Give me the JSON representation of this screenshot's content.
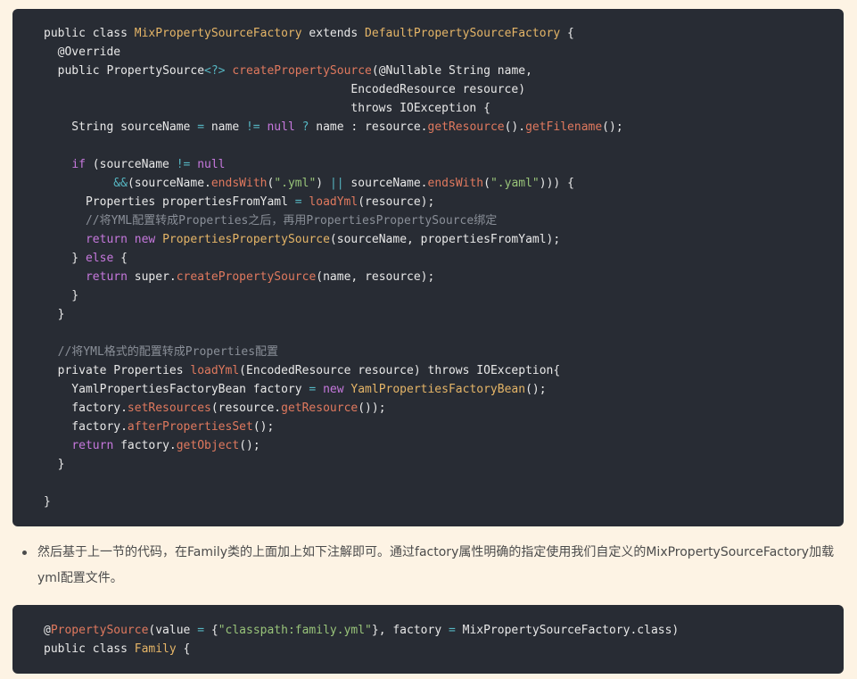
{
  "code_blocks": [
    {
      "lines": [
        [
          [
            "kw",
            "public class "
          ],
          [
            "type",
            "MixPropertySourceFactory"
          ],
          [
            "kw",
            " extends "
          ],
          [
            "type",
            "DefaultPropertySourceFactory"
          ],
          [
            "plain",
            " {"
          ]
        ],
        [
          [
            "plain",
            "  "
          ],
          [
            "ann",
            "@Override"
          ]
        ],
        [
          [
            "plain",
            "  "
          ],
          [
            "kw",
            "public "
          ],
          [
            "plain",
            "PropertySource"
          ],
          [
            "op",
            "<?>"
          ],
          [
            "plain",
            " "
          ],
          [
            "fn",
            "createPropertySource"
          ],
          [
            "plain",
            "("
          ],
          [
            "ann",
            "@Nullable"
          ],
          [
            "plain",
            " String name,"
          ]
        ],
        [
          [
            "plain",
            "                                            EncodedResource resource)"
          ]
        ],
        [
          [
            "plain",
            "                                            "
          ],
          [
            "kw",
            "throws"
          ],
          [
            "plain",
            " IOException {"
          ]
        ],
        [
          [
            "plain",
            "    String sourceName "
          ],
          [
            "op",
            "="
          ],
          [
            "plain",
            " name "
          ],
          [
            "op",
            "!="
          ],
          [
            "plain",
            " "
          ],
          [
            "kw2",
            "null"
          ],
          [
            "plain",
            " "
          ],
          [
            "op",
            "?"
          ],
          [
            "plain",
            " name : resource."
          ],
          [
            "fn",
            "getResource"
          ],
          [
            "plain",
            "()."
          ],
          [
            "fn",
            "getFilename"
          ],
          [
            "plain",
            "();"
          ]
        ],
        [],
        [
          [
            "plain",
            "    "
          ],
          [
            "kw2",
            "if"
          ],
          [
            "plain",
            " (sourceName "
          ],
          [
            "op",
            "!="
          ],
          [
            "plain",
            " "
          ],
          [
            "kw2",
            "null"
          ]
        ],
        [
          [
            "plain",
            "          "
          ],
          [
            "op",
            "&&"
          ],
          [
            "plain",
            "(sourceName."
          ],
          [
            "fn",
            "endsWith"
          ],
          [
            "plain",
            "("
          ],
          [
            "str",
            "\".yml\""
          ],
          [
            "plain",
            ") "
          ],
          [
            "op",
            "||"
          ],
          [
            "plain",
            " sourceName."
          ],
          [
            "fn",
            "endsWith"
          ],
          [
            "plain",
            "("
          ],
          [
            "str",
            "\".yaml\""
          ],
          [
            "plain",
            "))) {"
          ]
        ],
        [
          [
            "plain",
            "      Properties propertiesFromYaml "
          ],
          [
            "op",
            "="
          ],
          [
            "plain",
            " "
          ],
          [
            "fn",
            "loadYml"
          ],
          [
            "plain",
            "(resource);"
          ]
        ],
        [
          [
            "plain",
            "      "
          ],
          [
            "cm",
            "//将YML配置转成Properties之后，再用PropertiesPropertySource绑定"
          ]
        ],
        [
          [
            "plain",
            "      "
          ],
          [
            "kw2",
            "return"
          ],
          [
            "plain",
            " "
          ],
          [
            "kw2",
            "new"
          ],
          [
            "plain",
            " "
          ],
          [
            "type",
            "PropertiesPropertySource"
          ],
          [
            "plain",
            "(sourceName, propertiesFromYaml);"
          ]
        ],
        [
          [
            "plain",
            "    } "
          ],
          [
            "kw2",
            "else"
          ],
          [
            "plain",
            " {"
          ]
        ],
        [
          [
            "plain",
            "      "
          ],
          [
            "kw2",
            "return"
          ],
          [
            "plain",
            " super."
          ],
          [
            "fn",
            "createPropertySource"
          ],
          [
            "plain",
            "(name, resource);"
          ]
        ],
        [
          [
            "plain",
            "    }"
          ]
        ],
        [
          [
            "plain",
            "  }"
          ]
        ],
        [],
        [
          [
            "plain",
            "  "
          ],
          [
            "cm",
            "//将YML格式的配置转成Properties配置"
          ]
        ],
        [
          [
            "plain",
            "  "
          ],
          [
            "kw",
            "private"
          ],
          [
            "plain",
            " Properties "
          ],
          [
            "fn",
            "loadYml"
          ],
          [
            "plain",
            "(EncodedResource resource) "
          ],
          [
            "kw",
            "throws"
          ],
          [
            "plain",
            " IOException{"
          ]
        ],
        [
          [
            "plain",
            "    YamlPropertiesFactoryBean factory "
          ],
          [
            "op",
            "="
          ],
          [
            "plain",
            " "
          ],
          [
            "kw2",
            "new"
          ],
          [
            "plain",
            " "
          ],
          [
            "type",
            "YamlPropertiesFactoryBean"
          ],
          [
            "plain",
            "();"
          ]
        ],
        [
          [
            "plain",
            "    factory."
          ],
          [
            "fn",
            "setResources"
          ],
          [
            "plain",
            "(resource."
          ],
          [
            "fn",
            "getResource"
          ],
          [
            "plain",
            "());"
          ]
        ],
        [
          [
            "plain",
            "    factory."
          ],
          [
            "fn",
            "afterPropertiesSet"
          ],
          [
            "plain",
            "();"
          ]
        ],
        [
          [
            "plain",
            "    "
          ],
          [
            "kw2",
            "return"
          ],
          [
            "plain",
            " factory."
          ],
          [
            "fn",
            "getObject"
          ],
          [
            "plain",
            "();"
          ]
        ],
        [
          [
            "plain",
            "  }"
          ]
        ],
        [],
        [
          [
            "plain",
            "}"
          ]
        ]
      ]
    },
    {
      "lines": [
        [
          [
            "ann",
            "@"
          ],
          [
            "fn",
            "PropertySource"
          ],
          [
            "plain",
            "(value "
          ],
          [
            "op",
            "="
          ],
          [
            "plain",
            " {"
          ],
          [
            "str",
            "\"classpath:family.yml\""
          ],
          [
            "plain",
            "}, factory "
          ],
          [
            "op",
            "="
          ],
          [
            "plain",
            " MixPropertySourceFactory.class)"
          ]
        ],
        [
          [
            "kw",
            "public class "
          ],
          [
            "type",
            "Family"
          ],
          [
            "plain",
            " {"
          ]
        ]
      ]
    }
  ],
  "paragraph": {
    "text": "然后基于上一节的代码，在Family类的上面加上如下注解即可。通过factory属性明确的指定使用我们自定义的MixPropertySourceFactory加载yml配置文件。"
  },
  "colors": {
    "page_background": "#fdf3e4",
    "code_background": "#282c34",
    "keyword_purple": "#c678dd",
    "type_gold": "#e5b567",
    "function_orange": "#e0795e",
    "operator_cyan": "#56b6c2",
    "string_green": "#98c379",
    "comment_gray": "#8a8f98"
  }
}
